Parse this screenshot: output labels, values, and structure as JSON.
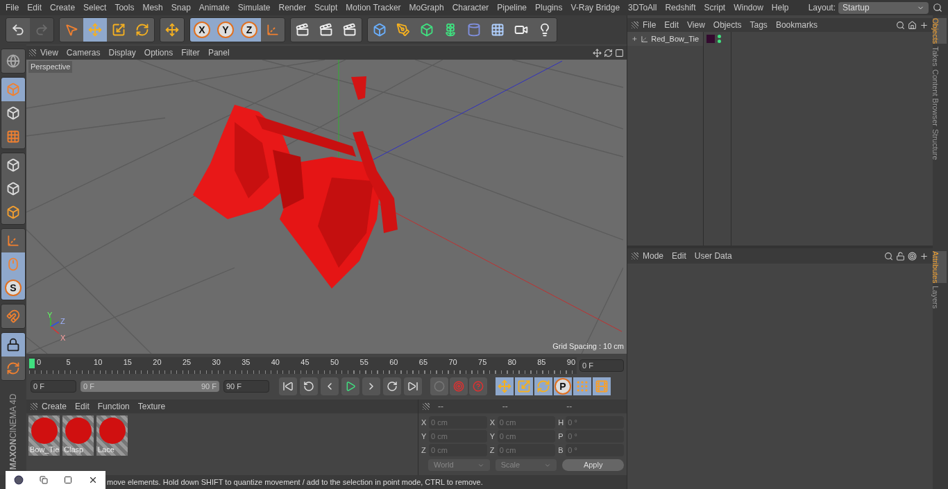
{
  "menu": [
    "File",
    "Edit",
    "Create",
    "Select",
    "Tools",
    "Mesh",
    "Snap",
    "Animate",
    "Simulate",
    "Render",
    "Sculpt",
    "Motion Tracker",
    "MoGraph",
    "Character",
    "Pipeline",
    "Plugins",
    "V-Ray Bridge",
    "3DToAll",
    "Redshift",
    "Script",
    "Window",
    "Help"
  ],
  "layout": {
    "label": "Layout:",
    "value": "Startup"
  },
  "toolbar": [
    [
      {
        "kind": "undo",
        "selected": false,
        "disabled": false
      },
      {
        "kind": "redo",
        "selected": false,
        "disabled": true
      }
    ],
    [
      {
        "kind": "select",
        "selected": false,
        "disabled": false
      },
      {
        "kind": "move",
        "selected": true,
        "disabled": false
      },
      {
        "kind": "scale",
        "selected": false,
        "disabled": false
      },
      {
        "kind": "rotate",
        "selected": false,
        "disabled": false
      }
    ],
    [
      {
        "kind": "move",
        "selected": false,
        "disabled": false
      }
    ],
    [
      {
        "kind": "letter",
        "label": "X",
        "selected": true,
        "disabled": false
      },
      {
        "kind": "letter",
        "label": "Y",
        "selected": true,
        "disabled": false
      },
      {
        "kind": "letter",
        "label": "Z",
        "selected": true,
        "disabled": false
      },
      {
        "kind": "coord",
        "selected": false,
        "disabled": false
      }
    ],
    [
      {
        "kind": "render",
        "selected": false,
        "disabled": false
      },
      {
        "kind": "render",
        "selected": false,
        "disabled": false
      },
      {
        "kind": "render",
        "selected": false,
        "disabled": false
      }
    ],
    [
      {
        "kind": "cube",
        "selected": false,
        "disabled": false
      },
      {
        "kind": "pen",
        "selected": false,
        "disabled": false
      },
      {
        "kind": "subdivision",
        "selected": false,
        "disabled": false
      },
      {
        "kind": "cloner",
        "selected": false,
        "disabled": false
      },
      {
        "kind": "deformer",
        "selected": false,
        "disabled": false
      },
      {
        "kind": "floor",
        "selected": false,
        "disabled": false
      },
      {
        "kind": "camera",
        "selected": false,
        "disabled": false
      },
      {
        "kind": "light",
        "selected": false,
        "disabled": false
      }
    ]
  ],
  "left_toolbar": [
    [
      {
        "kind": "sphere",
        "selected": false
      }
    ],
    [
      {
        "kind": "model",
        "selected": true
      },
      {
        "kind": "texture",
        "selected": false
      },
      {
        "kind": "workplane",
        "selected": false
      }
    ],
    [
      {
        "kind": "points",
        "selected": false
      },
      {
        "kind": "edges",
        "selected": false
      },
      {
        "kind": "polygons",
        "selected": false
      }
    ],
    [
      {
        "kind": "axis",
        "selected": false
      },
      {
        "kind": "tweak",
        "selected": true
      },
      {
        "kind": "letter",
        "label": "S",
        "selected": true
      }
    ],
    [
      {
        "kind": "magnet",
        "selected": false
      }
    ],
    [
      {
        "kind": "grid-lock",
        "selected": true
      },
      {
        "kind": "grid-refresh",
        "selected": false
      }
    ]
  ],
  "logo": {
    "brand": "MAXON",
    "product": "CINEMA 4D"
  },
  "viewport": {
    "menu": [
      "View",
      "Cameras",
      "Display",
      "Options",
      "Filter",
      "Panel"
    ],
    "camera": "Perspective",
    "grid_spacing": "Grid Spacing : 10 cm",
    "axes": {
      "y": "Y",
      "z": "Z",
      "x": "X"
    }
  },
  "timeline": {
    "ticks": [
      "0",
      "5",
      "10",
      "15",
      "20",
      "25",
      "30",
      "35",
      "40",
      "45",
      "50",
      "55",
      "60",
      "65",
      "70",
      "75",
      "80",
      "85",
      "90"
    ],
    "playhead": {
      "level": 0
    },
    "current_frame": "0 F",
    "start": "0 F",
    "range_start": "0 F",
    "range_end": "90 F",
    "range": {
      "level": 1
    },
    "end": "90 F"
  },
  "transport": [
    {
      "kind": "first"
    },
    {
      "kind": "prev-key"
    },
    {
      "kind": "prev-frame"
    },
    {
      "kind": "play"
    },
    {
      "kind": "next-frame"
    },
    {
      "kind": "next-key"
    },
    {
      "kind": "last"
    }
  ],
  "record": [
    {
      "kind": "record",
      "disabled": true
    },
    {
      "kind": "autokey",
      "disabled": false
    },
    {
      "kind": "help",
      "disabled": false
    }
  ],
  "key_modes": [
    {
      "kind": "move",
      "selected": true
    },
    {
      "kind": "scale",
      "selected": true
    },
    {
      "kind": "rotate",
      "selected": true
    },
    {
      "kind": "param",
      "label": "P",
      "selected": true
    },
    {
      "kind": "pla",
      "selected": true
    },
    {
      "kind": "film",
      "selected": true
    }
  ],
  "materials": {
    "menu": [
      "Create",
      "Edit",
      "Function",
      "Texture"
    ],
    "items": [
      {
        "name": "Bow_Tie",
        "color": "#d01010"
      },
      {
        "name": "Clasp",
        "color": "#d01010"
      },
      {
        "name": "Lace",
        "color": "#d01010"
      }
    ]
  },
  "coordinates": {
    "headers": [
      "--",
      "--",
      "--"
    ],
    "rows": [
      [
        {
          "axis": "X",
          "value": "0 cm"
        },
        {
          "axis": "X",
          "value": "0 cm"
        },
        {
          "axis": "H",
          "value": "0 °"
        }
      ],
      [
        {
          "axis": "Y",
          "value": "0 cm"
        },
        {
          "axis": "Y",
          "value": "0 cm"
        },
        {
          "axis": "P",
          "value": "0 °"
        }
      ],
      [
        {
          "axis": "Z",
          "value": "0 cm"
        },
        {
          "axis": "Z",
          "value": "0 cm"
        },
        {
          "axis": "B",
          "value": "0 °"
        }
      ]
    ],
    "space": "World",
    "mode": "Scale",
    "apply": "Apply"
  },
  "status": "move elements. Hold down SHIFT to quantize movement / add to the selection in point mode, CTRL to remove.",
  "objects": {
    "menu": [
      "File",
      "Edit",
      "View",
      "Objects",
      "Tags",
      "Bookmarks"
    ],
    "items": [
      {
        "name": "Red_Bow_Tie",
        "color": "#330a2e"
      }
    ]
  },
  "attributes": {
    "menu": [
      "Mode",
      "Edit",
      "User Data"
    ]
  },
  "side_tabs_top": [
    {
      "label": "Objects",
      "selected": true
    },
    {
      "label": "Takes",
      "selected": false
    },
    {
      "label": "Content Browser",
      "selected": false
    },
    {
      "label": "Structure",
      "selected": false
    }
  ],
  "side_tabs_bottom": [
    {
      "label": "Attributes",
      "selected": true
    },
    {
      "label": "Layers",
      "selected": false
    }
  ]
}
